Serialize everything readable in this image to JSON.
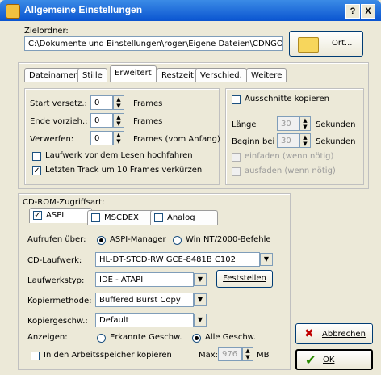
{
  "window": {
    "title": "Allgemeine Einstellungen",
    "help_label": "?",
    "close_label": "X"
  },
  "target": {
    "label": "Zielordner:",
    "path": "C:\\Dokumente und Einstellungen\\roger\\Eigene Dateien\\CDNGO",
    "browse_label": "Ort..."
  },
  "tabs": [
    "Dateinamen",
    "Stille",
    "Erweitert",
    "Restzeit",
    "Verschied.",
    "Weitere"
  ],
  "tabs_active": "Erweitert",
  "advanced": {
    "start_label": "Start versetz.:",
    "start_value": "0",
    "start_unit": "Frames",
    "end_label": "Ende vorzieh.:",
    "end_value": "0",
    "end_unit": "Frames",
    "discard_label": "Verwerfen:",
    "discard_value": "0",
    "discard_unit": "Frames (vom Anfang)",
    "spinup_label": "Laufwerk vor dem Lesen hochfahren",
    "spinup_checked": false,
    "lasttrack_label": "Letzten Track um 10 Frames verkürzen",
    "lasttrack_checked": true
  },
  "excerpts": {
    "copy_label": "Ausschnitte kopieren",
    "copy_checked": false,
    "length_label": "Länge",
    "length_value": "30",
    "length_unit": "Sekunden",
    "begin_label": "Beginn bei",
    "begin_value": "30",
    "begin_unit": "Sekunden",
    "fadein_label": "einfaden (wenn nötig)",
    "fadeout_label": "ausfaden (wenn nötig)"
  },
  "cdrom": {
    "group_label": "CD-ROM-Zugriffsart:",
    "subtabs": [
      {
        "label": "ASPI",
        "checked": true
      },
      {
        "label": "MSCDEX",
        "checked": false
      },
      {
        "label": "Analog",
        "checked": false
      }
    ],
    "call_label": "Aufrufen über:",
    "call_opt1": "ASPI-Manager",
    "call_opt2": "Win NT/2000-Befehle",
    "drive_label": "CD-Laufwerk:",
    "drive_value": "HL-DT-STCD-RW GCE-8481B C102",
    "drivetype_label": "Laufwerkstyp:",
    "drivetype_value": "IDE   - ATAPI",
    "detect_label": "Feststellen",
    "copymethod_label": "Kopiermethode:",
    "copymethod_value": "Buffered Burst Copy",
    "copyspeed_label": "Kopiergeschw.:",
    "copyspeed_value": "Default",
    "show_label": "Anzeigen:",
    "show_opt1": "Erkannte Geschw.",
    "show_opt2": "Alle Geschw.",
    "memcopy_label": "In den Arbeitsspeicher kopieren",
    "max_label": "Max:",
    "max_value": "976",
    "max_unit": "MB"
  },
  "buttons": {
    "cancel_label": "Abbrechen",
    "ok_label": "OK"
  },
  "colors": {
    "title_bar": "#0a54d0",
    "dialog_bg": "#ece9d8"
  }
}
